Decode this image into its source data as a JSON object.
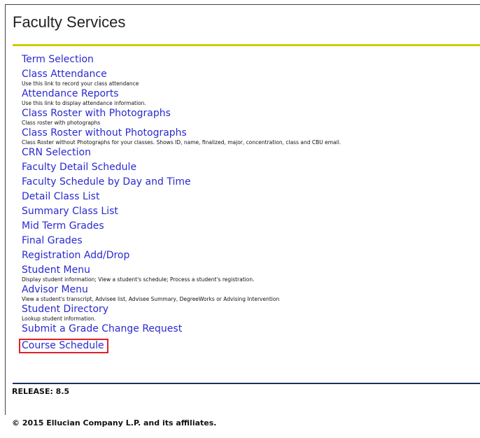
{
  "page": {
    "title": "Faculty Services",
    "release": "RELEASE: 8.5",
    "copyright": "© 2015 Ellucian Company L.P. and its affiliates."
  },
  "menu": {
    "items": [
      {
        "label": "Term Selection",
        "desc": ""
      },
      {
        "label": "Class Attendance",
        "desc": "Use this link to record your class attendance"
      },
      {
        "label": "Attendance Reports",
        "desc": "Use this link to display attendance information."
      },
      {
        "label": "Class Roster with Photographs",
        "desc": "Class roster with photographs"
      },
      {
        "label": "Class Roster without Photographs",
        "desc": "Class Roster without Photographs for your classes. Shows ID, name, finalized, major, concentration, class and CBU email."
      },
      {
        "label": "CRN Selection",
        "desc": ""
      },
      {
        "label": "Faculty Detail Schedule",
        "desc": ""
      },
      {
        "label": "Faculty Schedule by Day and Time",
        "desc": ""
      },
      {
        "label": "Detail Class List",
        "desc": ""
      },
      {
        "label": "Summary Class List",
        "desc": ""
      },
      {
        "label": "Mid Term Grades",
        "desc": ""
      },
      {
        "label": "Final Grades",
        "desc": ""
      },
      {
        "label": "Registration Add/Drop",
        "desc": ""
      },
      {
        "label": "Student Menu",
        "desc": "Display student information; View a student's schedule; Process a student's registration."
      },
      {
        "label": "Advisor Menu",
        "desc": "View a student's transcript, Advisee list, Advisee Summary, DegreeWorks or Advising Intervention"
      },
      {
        "label": "Student Directory",
        "desc": "Lookup student information."
      },
      {
        "label": "Submit a Grade Change Request",
        "desc": ""
      },
      {
        "label": "Course Schedule",
        "desc": ""
      }
    ]
  },
  "colors": {
    "link": "#2a2ad0",
    "title_rule": "#cccc00",
    "bottom_rule": "#1c2e66",
    "highlight_box": "#e0202a"
  }
}
